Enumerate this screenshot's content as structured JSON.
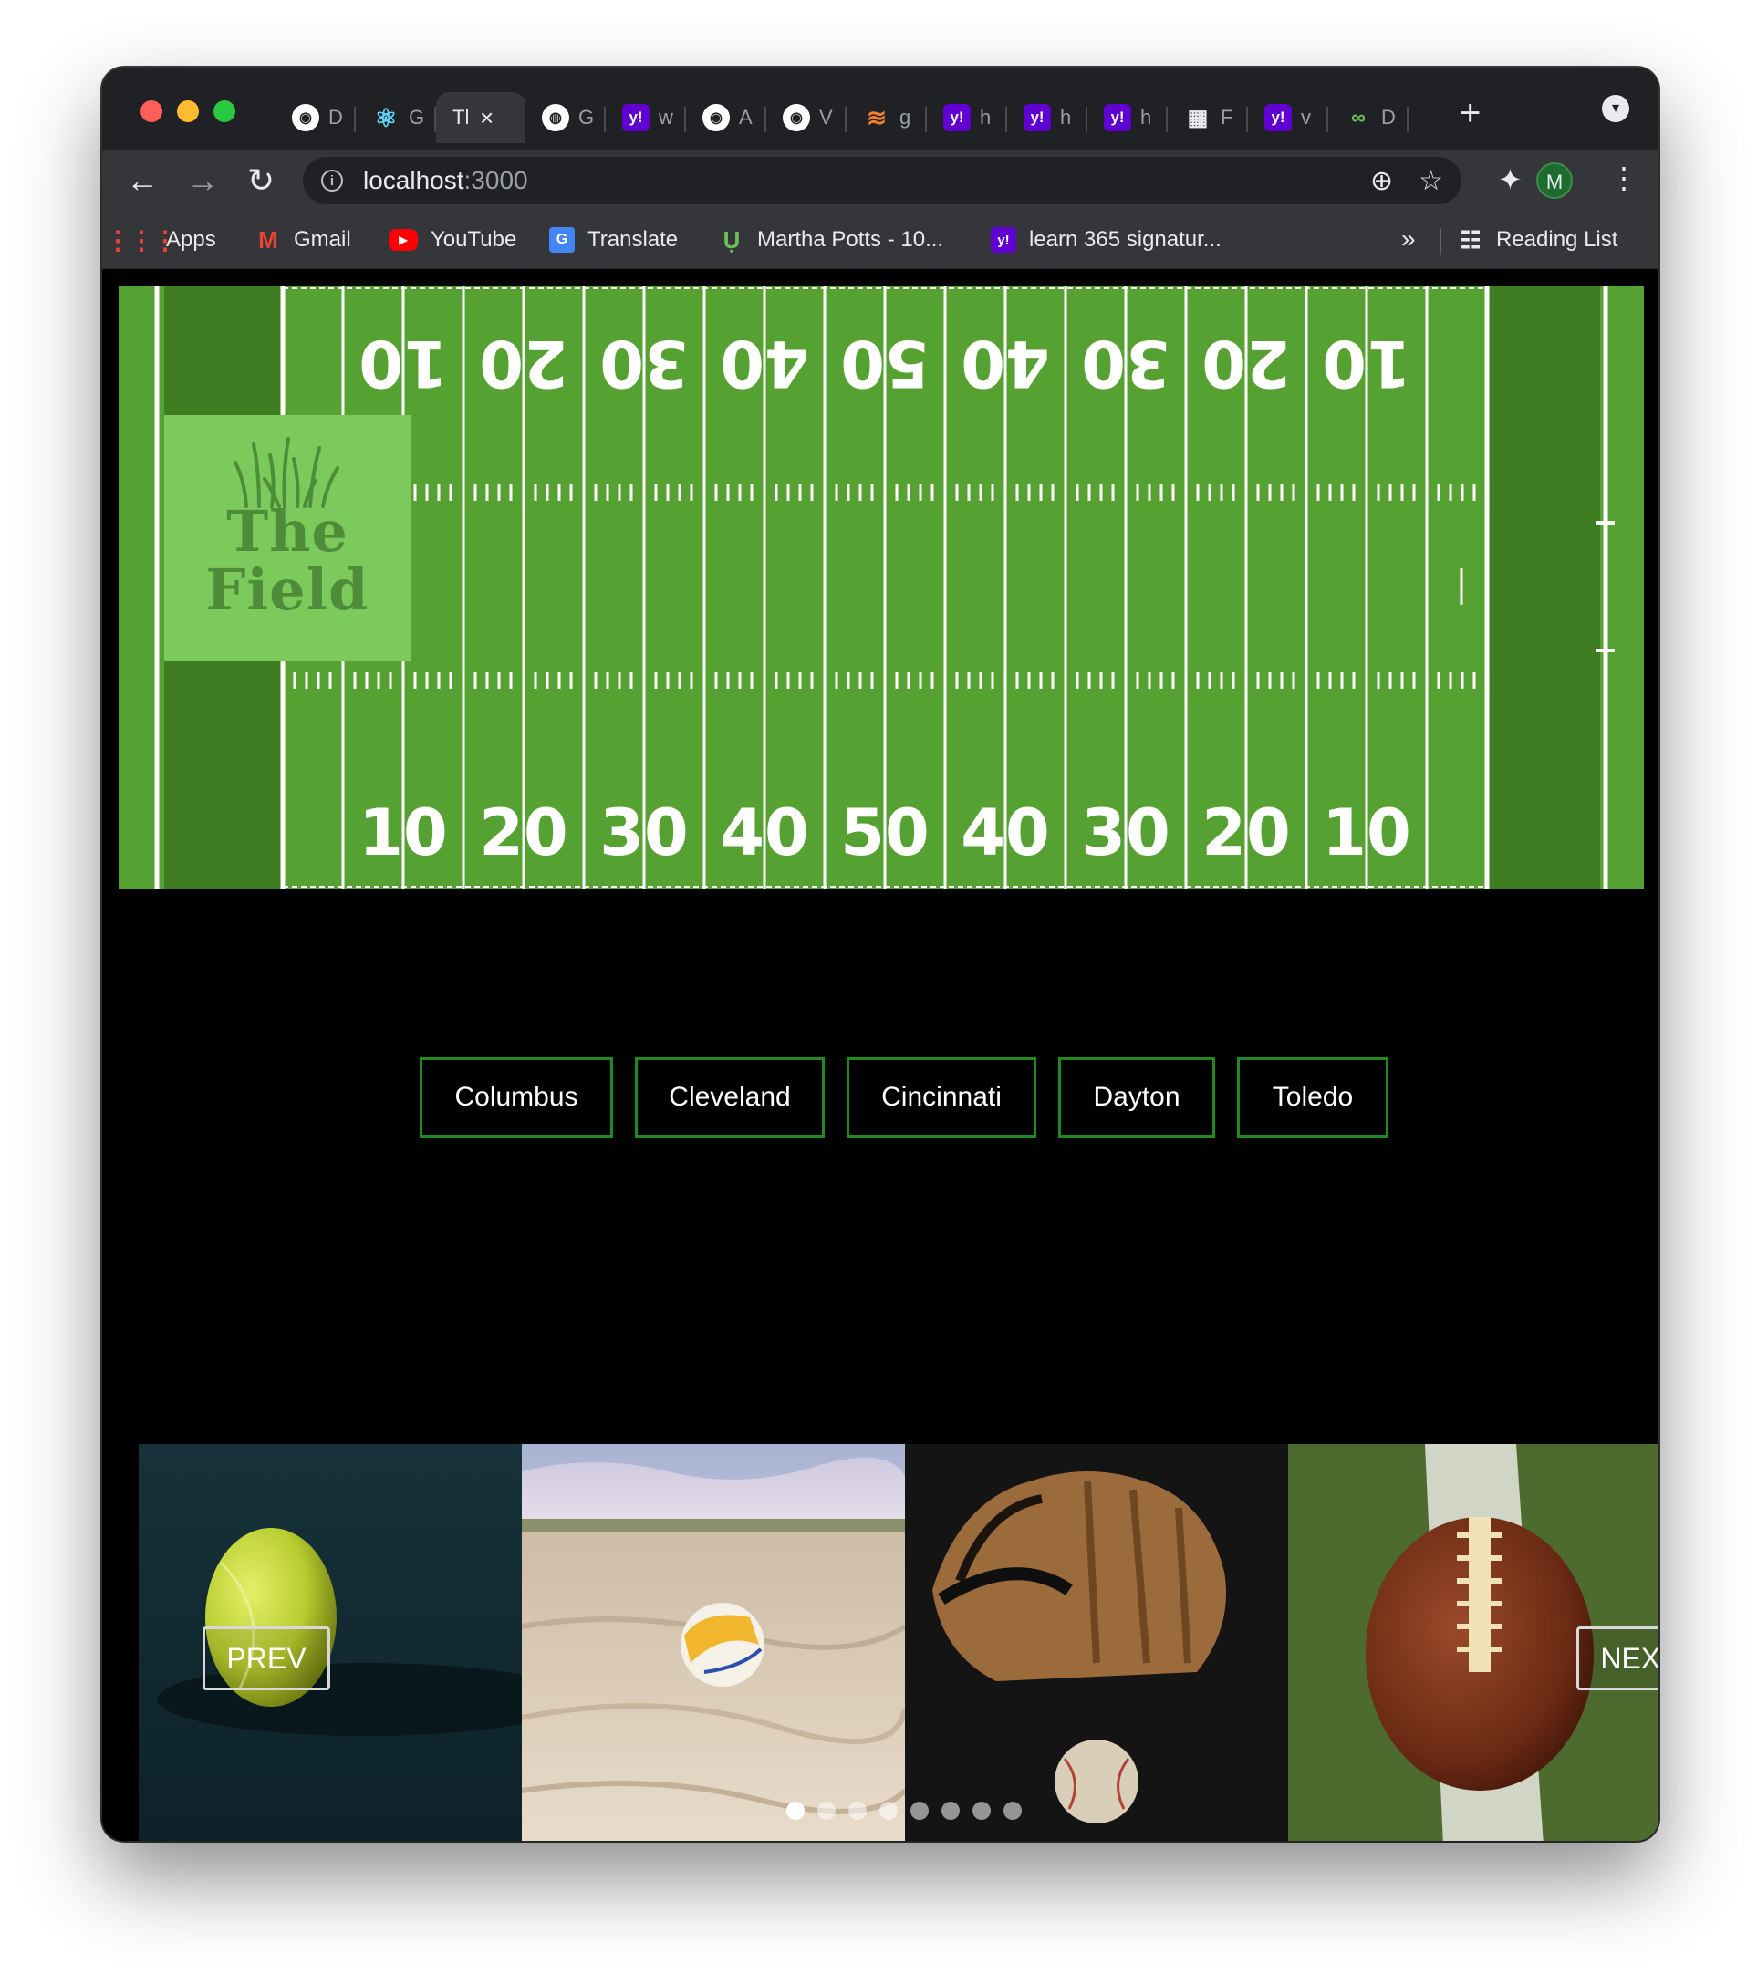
{
  "browser": {
    "tabs": [
      {
        "icon": "github-icon",
        "title": "D"
      },
      {
        "icon": "react-icon",
        "title": "G"
      },
      {
        "icon": "none",
        "title": "Tl",
        "active": true
      },
      {
        "icon": "globe-icon",
        "title": "G"
      },
      {
        "icon": "yahoo-icon",
        "title": "w"
      },
      {
        "icon": "github-icon",
        "title": "A"
      },
      {
        "icon": "github-icon",
        "title": "V"
      },
      {
        "icon": "stackoverflow-icon",
        "title": "g"
      },
      {
        "icon": "yahoo-icon",
        "title": "h"
      },
      {
        "icon": "yahoo-icon",
        "title": "h"
      },
      {
        "icon": "yahoo-icon",
        "title": "h"
      },
      {
        "icon": "grid-icon",
        "title": "F"
      },
      {
        "icon": "yahoo-icon",
        "title": "v"
      },
      {
        "icon": "d3-icon",
        "title": "D"
      }
    ],
    "url_host": "localhost",
    "url_port": ":3000",
    "profile_initial": "M",
    "bookmarks": {
      "apps": "Apps",
      "gmail": "Gmail",
      "youtube": "YouTube",
      "translate": "Translate",
      "martha": "Martha Potts - 10...",
      "learn": "learn 365 signatur...",
      "more": "»",
      "reading_list": "Reading List"
    }
  },
  "hero": {
    "logo_line1": "The",
    "logo_line2": "Field",
    "field_color": "#55a131",
    "endzone_color": "#3f7d22",
    "yard_numbers": [
      "10",
      "20",
      "30",
      "40",
      "50",
      "40",
      "30",
      "20",
      "10"
    ]
  },
  "city_nav": {
    "columbus": "Columbus",
    "cleveland": "Cleveland",
    "cincinnati": "Cincinnati",
    "dayton": "Dayton",
    "toledo": "Toledo"
  },
  "carousel": {
    "prev_label": "PREV",
    "next_label": "NEXT",
    "slides": [
      "tennis-ball",
      "beach-volleyball",
      "baseball-glove",
      "football"
    ],
    "dot_count": 8,
    "active_dot_index": 0
  }
}
